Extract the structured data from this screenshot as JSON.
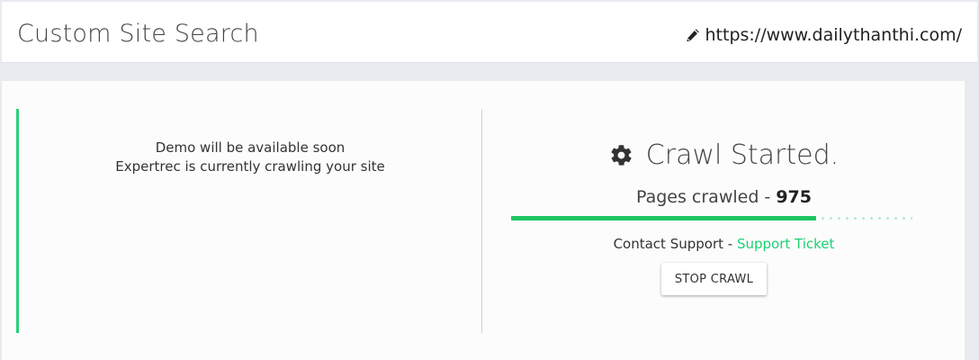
{
  "header": {
    "title": "Custom Site Search",
    "site_url": "https://www.dailythanthi.com/",
    "edit_icon": "pencil-icon"
  },
  "demo": {
    "line1": "Demo will be available soon",
    "line2": "Expertrec is currently crawling your site"
  },
  "crawl": {
    "status_icon": "gear-icon",
    "status": "Crawl Started.",
    "pages_label": "Pages crawled - ",
    "pages_count": "975",
    "progress_fraction": 0.76,
    "support_label": "Contact Support - ",
    "support_link": "Support Ticket",
    "stop_button": "STOP CRAWL"
  },
  "colors": {
    "accent_green": "#1ecf73",
    "progress_fill": "#1fc462",
    "left_border": "#2ad07a"
  }
}
